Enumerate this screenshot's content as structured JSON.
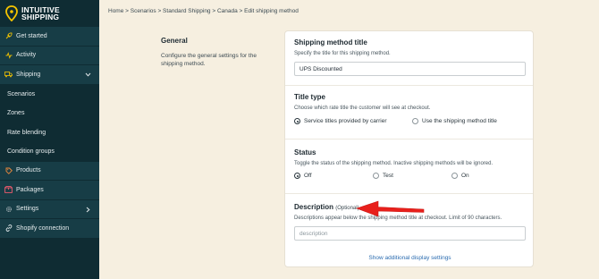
{
  "brand": {
    "line1": "INTUITIVE",
    "line2": "SHIPPING"
  },
  "sidebar": {
    "items": [
      {
        "label": "Get started",
        "icon": "rocket-icon",
        "kind": "top"
      },
      {
        "label": "Activity",
        "icon": "activity-icon",
        "kind": "top"
      },
      {
        "label": "Shipping",
        "icon": "truck-icon",
        "kind": "top",
        "chevron": "chevron-down-icon"
      },
      {
        "label": "Scenarios",
        "kind": "sub"
      },
      {
        "label": "Zones",
        "kind": "sub"
      },
      {
        "label": "Rate blending",
        "kind": "sub"
      },
      {
        "label": "Condition groups",
        "kind": "sub"
      },
      {
        "label": "Products",
        "icon": "tag-icon",
        "kind": "top"
      },
      {
        "label": "Packages",
        "icon": "package-icon",
        "kind": "top"
      },
      {
        "label": "Settings",
        "icon": "gear-icon",
        "kind": "top",
        "chevron": "chevron-right-icon"
      },
      {
        "label": "Shopify connection",
        "icon": "link-icon",
        "kind": "top"
      }
    ]
  },
  "breadcrumb": {
    "text": "Home > Scenarios > Standard Shipping > Canada > Edit shipping method"
  },
  "general": {
    "title": "General",
    "description": "Configure the general settings for the shipping method."
  },
  "method_title": {
    "title": "Shipping method title",
    "help": "Specify the title for this shipping method.",
    "value": "UPS Discounted"
  },
  "title_type": {
    "title": "Title type",
    "help": "Choose which rate title the customer will see at checkout.",
    "options": [
      {
        "label": "Service titles provided by carrier",
        "selected": true
      },
      {
        "label": "Use the shipping method title",
        "selected": false
      }
    ]
  },
  "status": {
    "title": "Status",
    "help": "Toggle the status of the shipping method. Inactive shipping methods will be ignored.",
    "options": [
      {
        "label": "Off",
        "selected": true
      },
      {
        "label": "Test",
        "selected": false
      },
      {
        "label": "On",
        "selected": false
      }
    ]
  },
  "description": {
    "title": "Description",
    "optional": "(Optional)",
    "help": "Descriptions appear below the shipping method title at checkout. Limit of 90 characters.",
    "placeholder": "description"
  },
  "show_more": "Show additional display settings",
  "colors": {
    "sidebar": "#0f2c33",
    "accent_yellow": "#f5c400",
    "arrow_red": "#e8201c",
    "link": "#2b6cb0",
    "page": "#f6efe0"
  }
}
